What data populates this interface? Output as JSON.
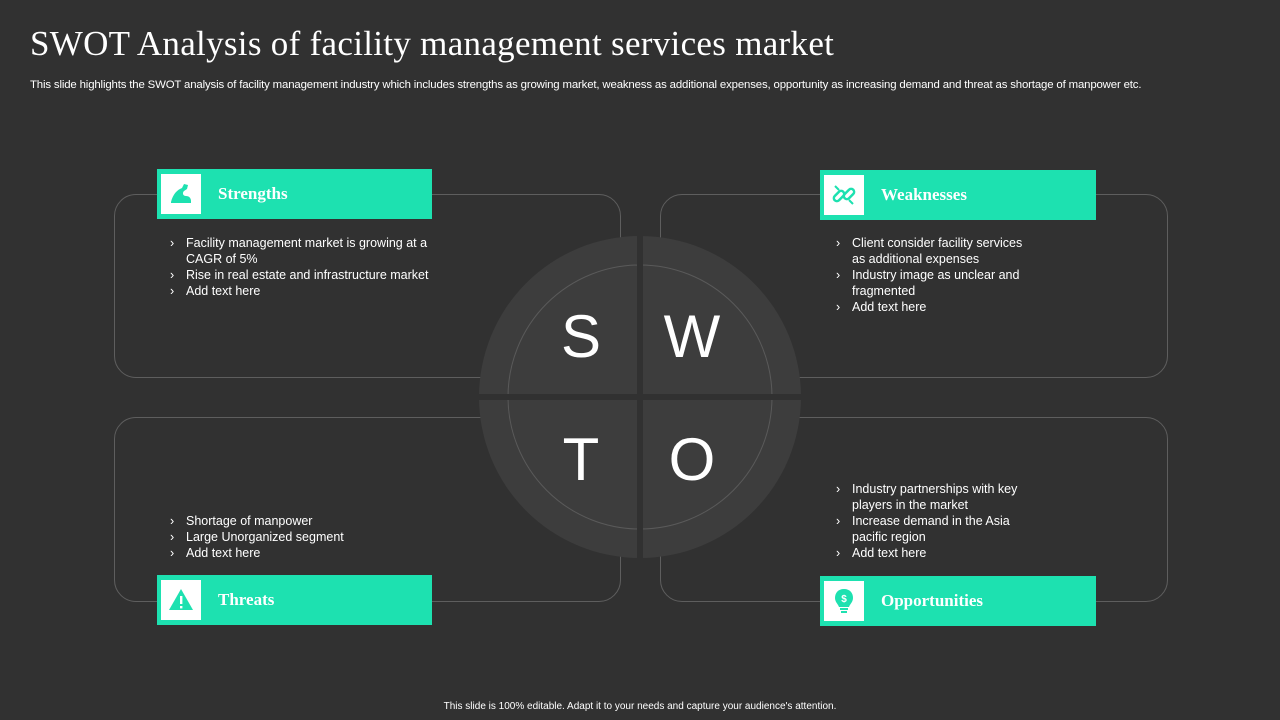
{
  "header": {
    "title": "SWOT Analysis of facility management services market",
    "subtitle": "This slide highlights the SWOT analysis of facility management industry which includes strengths as growing market, weakness as additional expenses, opportunity as increasing demand and threat as shortage of manpower etc."
  },
  "colors": {
    "accent": "#1de1b0",
    "background": "#313131",
    "circle": "#3d3d3d"
  },
  "swot_letters": {
    "s": "S",
    "w": "W",
    "t": "T",
    "o": "O"
  },
  "strengths": {
    "label": "Strengths",
    "icon": "flexed-arm-icon",
    "items": [
      "Facility management market is growing at a CAGR of 5%",
      "Rise in real estate and infrastructure  market",
      "Add text here"
    ]
  },
  "weaknesses": {
    "label": "Weaknesses",
    "icon": "broken-link-icon",
    "items": [
      "Client consider facility services as additional expenses",
      "Industry image as unclear and fragmented",
      "Add text here"
    ]
  },
  "threats": {
    "label": "Threats",
    "icon": "warning-icon",
    "items": [
      "Shortage of manpower",
      "Large Unorganized  segment",
      "Add text here"
    ]
  },
  "opportunities": {
    "label": "Opportunities",
    "icon": "lightbulb-dollar-icon",
    "items": [
      "Industry partnerships with key players in the market",
      "Increase demand  in the Asia pacific region",
      "Add text here"
    ]
  },
  "footer": {
    "text": "This slide is 100% editable.  Adapt it to your needs and capture your audience's attention."
  }
}
